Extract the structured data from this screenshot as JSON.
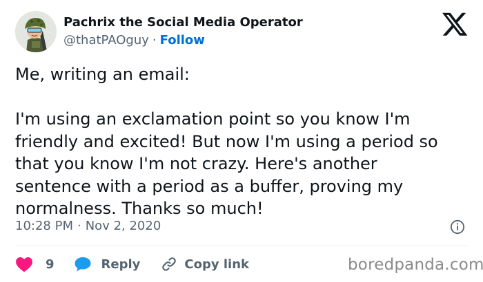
{
  "author": {
    "display_name": "Pachrix the Social Media Operator",
    "handle": "@thatPAOguy",
    "separator": "·",
    "follow_label": "Follow"
  },
  "tweet": {
    "lines": [
      "Me, writing an email:",
      "I'm using an exclamation point so you know I'm",
      "friendly and excited! But now I'm using a period so",
      "that you know I'm not crazy. Here's another",
      "sentence with a period as a buffer, proving my",
      "normalness. Thanks so much!"
    ]
  },
  "meta": {
    "time": "10:28 PM",
    "separator": "·",
    "date": "Nov 2, 2020"
  },
  "actions": {
    "like_count": "9",
    "reply_label": "Reply",
    "copy_link_label": "Copy link"
  },
  "watermark": "boredpanda.com",
  "colors": {
    "accent": "#006fd6",
    "like": "#f91880",
    "reply": "#1d9bf0",
    "muted": "#536471",
    "text": "#0f1419"
  },
  "icons": [
    "avatar-soldier-cartoon",
    "x-logo-icon",
    "info-icon",
    "heart-icon",
    "speech-bubble-icon",
    "link-icon"
  ]
}
